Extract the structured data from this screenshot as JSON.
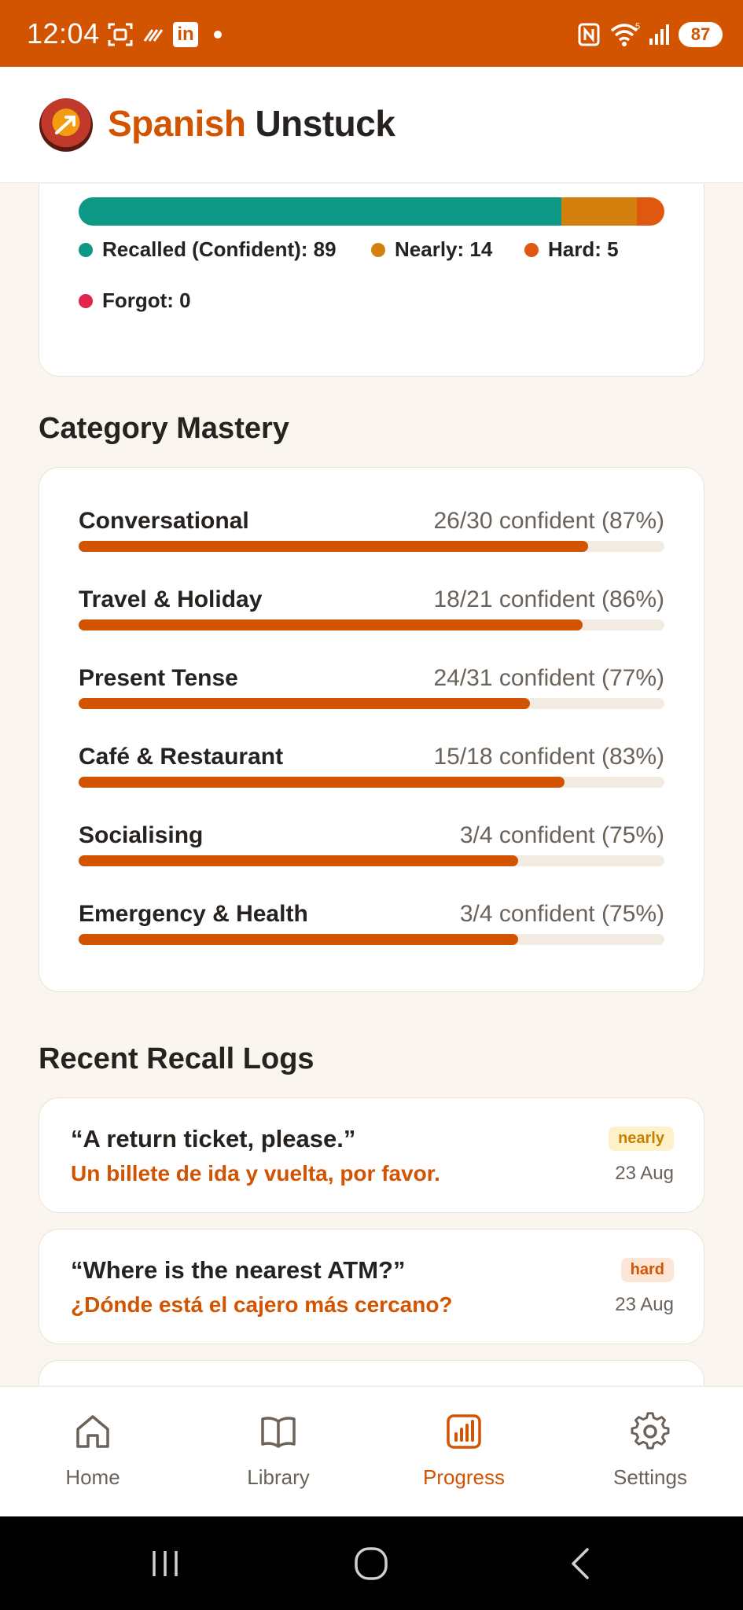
{
  "status_bar": {
    "time": "12:04",
    "linkedin": "in",
    "battery": "87"
  },
  "header": {
    "brand_part1": "Spanish",
    "brand_part2": "Unstuck"
  },
  "recall_summary": {
    "segments": [
      {
        "label": "Recalled (Confident): 89",
        "count": 89,
        "color": "#0e9886"
      },
      {
        "label": "Nearly: 14",
        "count": 14,
        "color": "#d4800f"
      },
      {
        "label": "Hard: 5",
        "count": 5,
        "color": "#e0580f"
      },
      {
        "label": "Forgot: 0",
        "count": 0,
        "color": "#e0254f"
      }
    ]
  },
  "category_mastery": {
    "title": "Category Mastery",
    "items": [
      {
        "name": "Conversational",
        "stat": "26/30 confident (87%)",
        "percent": 87
      },
      {
        "name": "Travel & Holiday",
        "stat": "18/21 confident (86%)",
        "percent": 86
      },
      {
        "name": "Present Tense",
        "stat": "24/31 confident (77%)",
        "percent": 77
      },
      {
        "name": "Café & Restaurant",
        "stat": "15/18 confident (83%)",
        "percent": 83
      },
      {
        "name": "Socialising",
        "stat": "3/4 confident (75%)",
        "percent": 75
      },
      {
        "name": "Emergency & Health",
        "stat": "3/4 confident (75%)",
        "percent": 75
      }
    ]
  },
  "recent_logs": {
    "title": "Recent Recall Logs",
    "items": [
      {
        "english": "“A return ticket, please.”",
        "spanish": "Un billete de ida y vuelta, por favor.",
        "badge": "nearly",
        "date": "23 Aug",
        "badge_bg": "#fdf1c9",
        "badge_color": "#c98000"
      },
      {
        "english": "“Where is the nearest ATM?”",
        "spanish": "¿Dónde está el cajero más cercano?",
        "badge": "hard",
        "date": "23 Aug",
        "badge_bg": "#fde6d8",
        "badge_color": "#d35400"
      }
    ]
  },
  "bottom_nav": {
    "items": [
      {
        "label": "Home",
        "icon": "home-icon",
        "active": false
      },
      {
        "label": "Library",
        "icon": "book-icon",
        "active": false
      },
      {
        "label": "Progress",
        "icon": "chart-icon",
        "active": true
      },
      {
        "label": "Settings",
        "icon": "gear-icon",
        "active": false
      }
    ]
  },
  "colors": {
    "brand": "#d35400",
    "status_bar": "#d35400",
    "background": "#faf6ef"
  }
}
